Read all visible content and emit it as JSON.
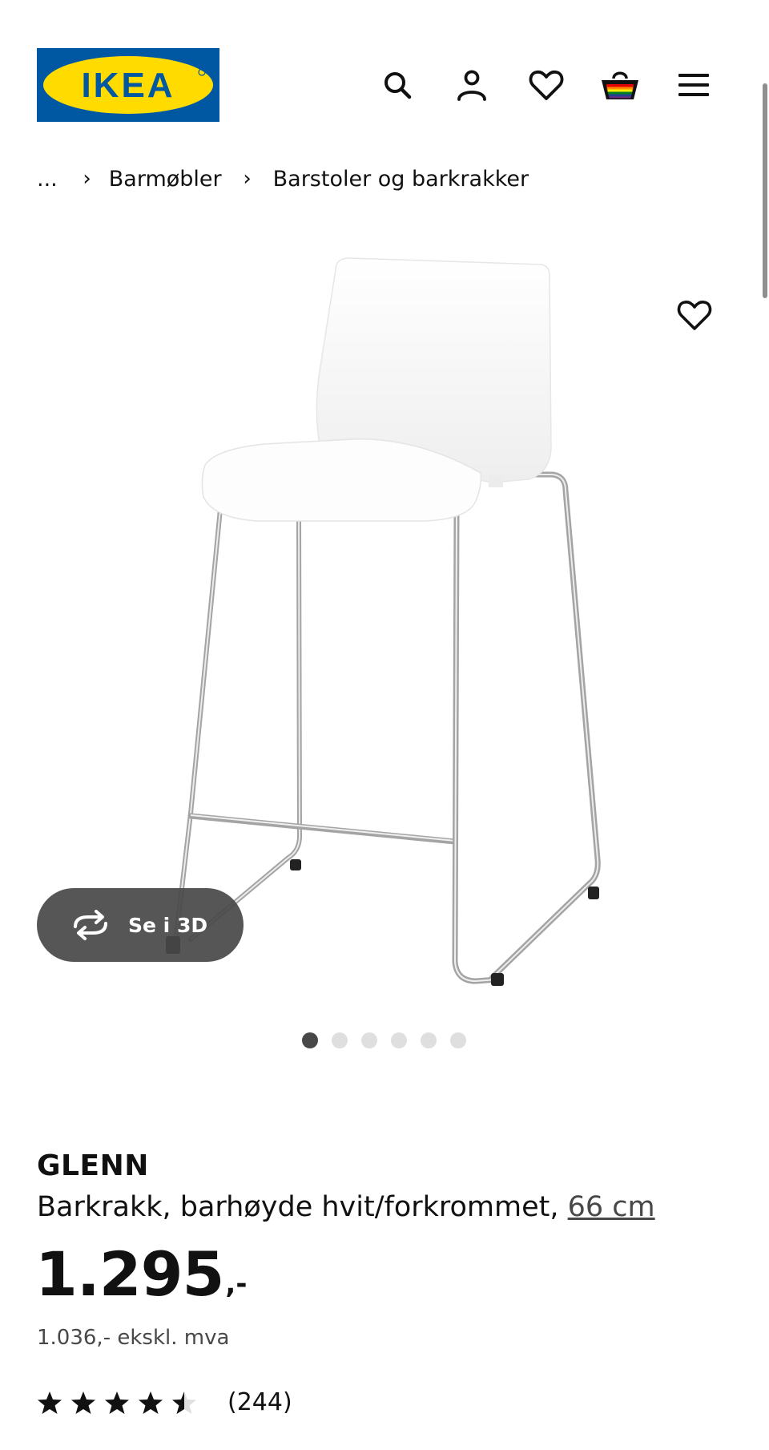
{
  "brand": {
    "logo_text": "IKEA",
    "blue": "#0058a3",
    "yellow": "#ffdb00"
  },
  "header": {
    "icons": [
      "search-icon",
      "account-icon",
      "heart-icon",
      "basket-icon",
      "menu-icon"
    ]
  },
  "breadcrumb": {
    "ellipsis": "...",
    "items": [
      "Barmøbler",
      "Barstoler og barkrakker"
    ]
  },
  "gallery": {
    "see_3d_label": "Se i 3D",
    "image_count": 6,
    "active_image": 1
  },
  "product": {
    "name": "GLENN",
    "description": "Barkrakk, barhøyde hvit/forkrommet,",
    "size_link": "66 cm",
    "price": "1.295",
    "price_suffix": ",-",
    "price_ex_vat": "1.036,- ekskl. mva",
    "rating": 4.5,
    "rating_max": 5,
    "review_count": "(244)"
  }
}
